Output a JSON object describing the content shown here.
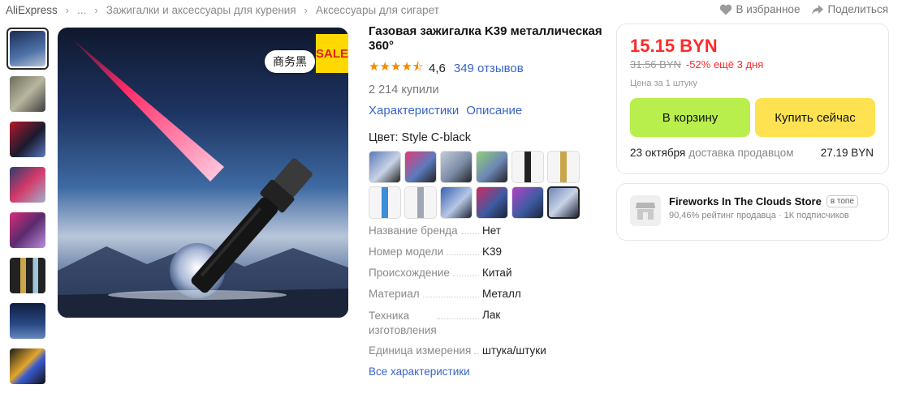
{
  "breadcrumb": {
    "items": [
      "AliExpress",
      "...",
      "Зажигалки и аксессуары для курения",
      "Аксессуары для сигарет"
    ]
  },
  "top_actions": {
    "favorite": "В избранное",
    "share": "Поделиться"
  },
  "main_image": {
    "badge": "商务黑",
    "sale": "SALE"
  },
  "product": {
    "title": "Газовая зажигалка K39 металлическая 360°",
    "rating": "4,6",
    "reviews": "349 отзывов",
    "sold": "2 214 купили",
    "link_specs": "Характеристики",
    "link_description": "Описание",
    "color_label": "Цвет: Style C-black",
    "specs": [
      {
        "key": "Название бренда",
        "value": "Нет"
      },
      {
        "key": "Номер модели",
        "value": "K39"
      },
      {
        "key": "Происхождение",
        "value": "Китай"
      },
      {
        "key": "Материал",
        "value": "Металл"
      },
      {
        "key": "Техника изготовления",
        "value": "Лак"
      },
      {
        "key": "Единица измерения",
        "value": "штука/штуки"
      }
    ],
    "all_specs": "Все характеристики"
  },
  "buy": {
    "price": "15.15 BYN",
    "old_price": "31.56 BYN",
    "discount": "-52% ещё 3 дня",
    "per_unit": "Цена за 1 штуку",
    "cart_label": "В корзину",
    "buy_label": "Купить сейчас",
    "delivery_date": "23 октября",
    "delivery_text": "доставка продавцом",
    "delivery_price": "27.19 BYN"
  },
  "store": {
    "name": "Fireworks In The Clouds Store",
    "tag": "в топе",
    "sub": "90,46% рейтинг продавца · 1К подписчиков"
  },
  "colors": {
    "accent_red": "#ff2a2a",
    "link_blue": "#3a64c8",
    "cart_green": "#b9ef4c",
    "buy_yellow": "#ffe251"
  }
}
